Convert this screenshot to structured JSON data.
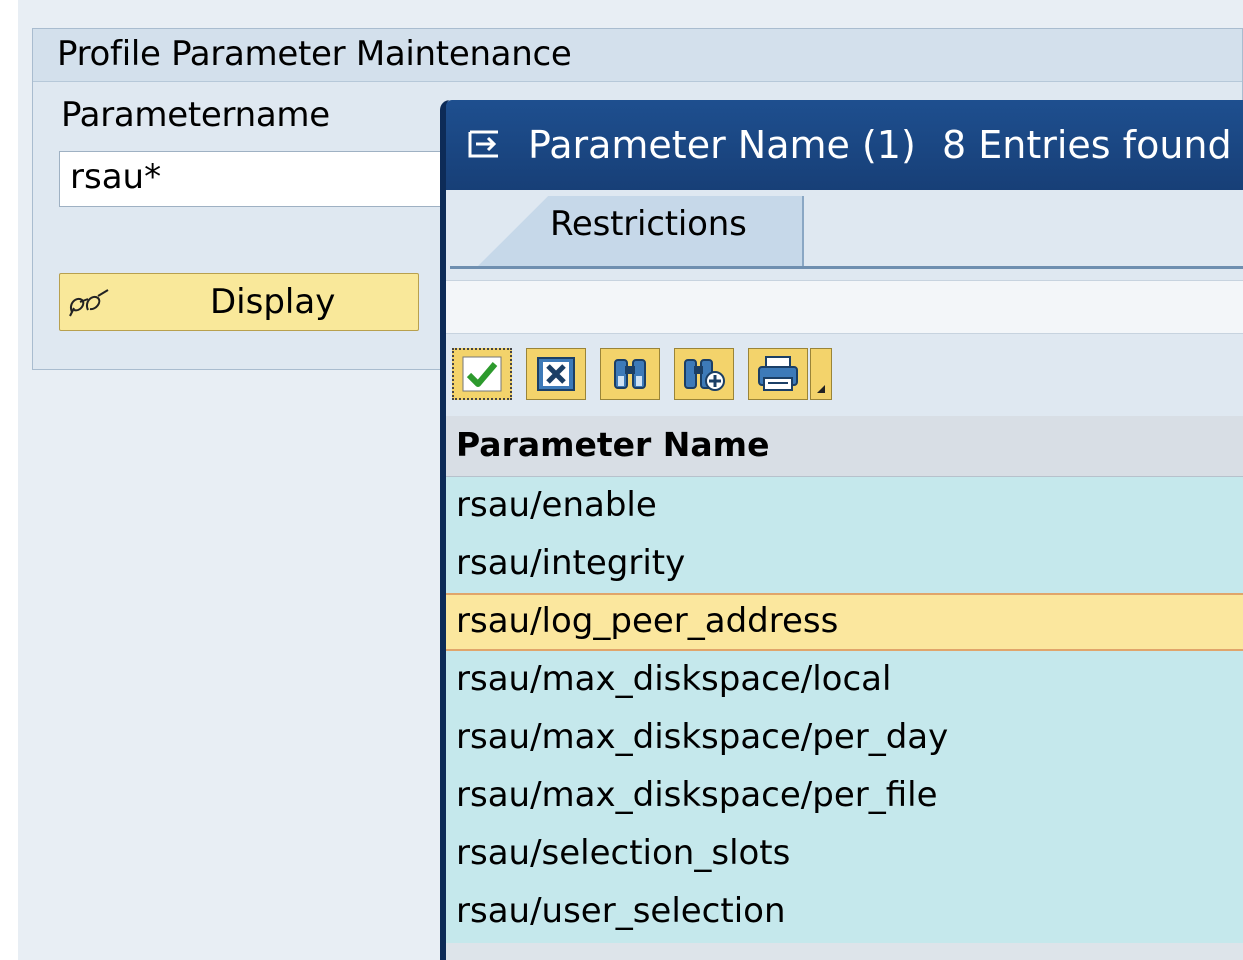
{
  "main": {
    "title": "Profile Parameter Maintenance",
    "field_label": "Parametername",
    "field_value": "rsau*",
    "display_button": "Display"
  },
  "dialog": {
    "title": "Parameter Name (1)",
    "entries_found": "8 Entries found",
    "tab_label": "Restrictions",
    "toolbar": [
      {
        "name": "confirm-icon"
      },
      {
        "name": "cancel-icon"
      },
      {
        "name": "find-icon"
      },
      {
        "name": "find-next-icon"
      },
      {
        "name": "print-icon"
      }
    ],
    "column_header": "Parameter Name",
    "rows": [
      "rsau/enable",
      "rsau/integrity",
      "rsau/log_peer_address",
      "rsau/max_diskspace/local",
      "rsau/max_diskspace/per_day",
      "rsau/max_diskspace/per_file",
      "rsau/selection_slots",
      "rsau/user_selection"
    ],
    "selected_row": 2
  },
  "colors": {
    "title_bar": "#1e4f8f",
    "list_bg": "#c5e8ec",
    "selected_row": "#fbe79e",
    "button": "#f9e89a"
  }
}
